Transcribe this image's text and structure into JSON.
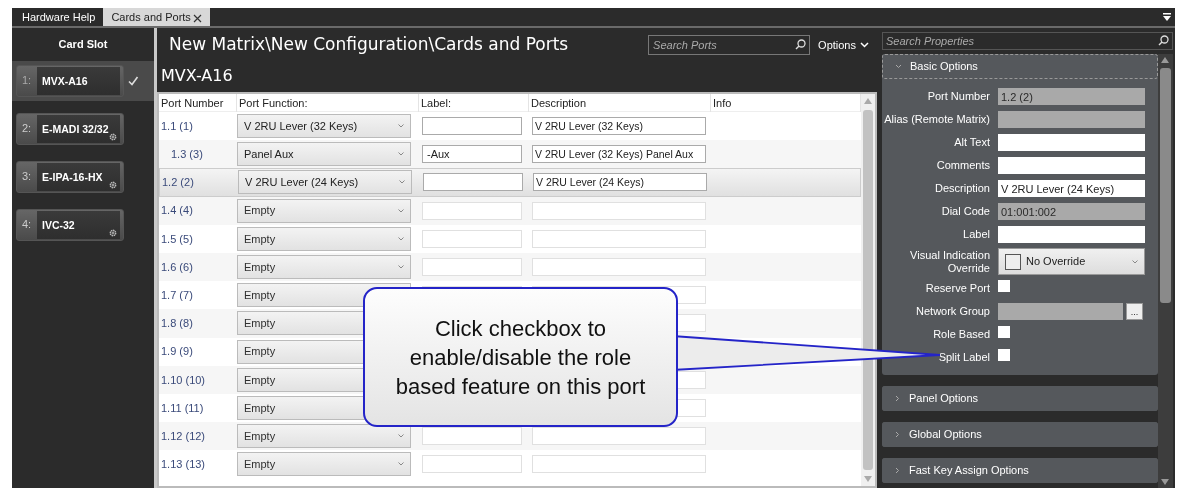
{
  "tabs": [
    {
      "label": "Hardware Help",
      "selected": false,
      "closable": false
    },
    {
      "label": "Cards and Ports",
      "selected": true,
      "closable": true
    }
  ],
  "card_slot": {
    "title": "Card Slot",
    "cards": [
      {
        "number": "1:",
        "name": "MVX-A16",
        "selected": true
      },
      {
        "number": "2:",
        "name": "E-MADI 32/32",
        "selected": false
      },
      {
        "number": "3:",
        "name": "E-IPA-16-HX",
        "selected": false
      },
      {
        "number": "4:",
        "name": "IVC-32",
        "selected": false
      }
    ]
  },
  "header": {
    "path": "New Matrix\\New Configuration\\Cards and Ports",
    "search": {
      "placeholder": "Search Ports"
    },
    "options": "Options"
  },
  "card_title": "MVX-A16",
  "table": {
    "columns": [
      "Port Number",
      "Port Function:",
      "Label:",
      "Description",
      "Info"
    ],
    "rows": [
      {
        "port": "1.1 (1)",
        "function": "V 2RU Lever (32 Keys)",
        "description": "V 2RU Lever (32 Keys)",
        "selected": false,
        "disabled": false,
        "children": [
          {
            "port": "1.3 (3)",
            "function": "Panel Aux",
            "label": "-Aux",
            "description": "V 2RU Lever (32 Keys) Panel Aux",
            "selected": false,
            "disabled": false
          }
        ]
      },
      {
        "port": "1.2 (2)",
        "function": "V 2RU Lever (24 Keys)",
        "description": "V 2RU Lever (24 Keys)",
        "selected": true,
        "disabled": false
      },
      {
        "port": "1.4 (4)",
        "function": "Empty",
        "selected": false,
        "disabled": true
      },
      {
        "port": "1.5 (5)",
        "function": "Empty",
        "selected": false,
        "disabled": true
      },
      {
        "port": "1.6 (6)",
        "function": "Empty",
        "selected": false,
        "disabled": true
      },
      {
        "port": "1.7 (7)",
        "function": "Empty",
        "selected": false,
        "disabled": true
      },
      {
        "port": "1.8 (8)",
        "function": "Empty",
        "selected": false,
        "disabled": true
      },
      {
        "port": "1.9 (9)",
        "function": "Empty",
        "selected": false,
        "disabled": true
      },
      {
        "port": "1.10 (10)",
        "function": "Empty",
        "selected": false,
        "disabled": true
      },
      {
        "port": "1.11 (11)",
        "function": "Empty",
        "selected": false,
        "disabled": true
      },
      {
        "port": "1.12 (12)",
        "function": "Empty",
        "selected": false,
        "disabled": true
      },
      {
        "port": "1.13 (13)",
        "function": "Empty",
        "selected": false,
        "disabled": true
      }
    ]
  },
  "properties": {
    "search": {
      "placeholder": "Search Properties"
    },
    "sections": [
      {
        "title": "Basic Options",
        "expanded": true,
        "fields": [
          {
            "label": "Port Number",
            "kind": "text",
            "value": "1.2 (2)",
            "readonly": true
          },
          {
            "label": "Alias (Remote Matrix)",
            "kind": "text",
            "readonly": true
          },
          {
            "label": "Alt Text",
            "kind": "text",
            "readonly": false
          },
          {
            "label": "Comments",
            "kind": "text",
            "readonly": false
          },
          {
            "label": "Description",
            "kind": "text",
            "value": "V 2RU Lever (24 Keys)",
            "readonly": false
          },
          {
            "label": "Dial Code",
            "kind": "text",
            "value": "01:001:002",
            "readonly": true
          },
          {
            "label": "Label",
            "kind": "text",
            "readonly": false
          },
          {
            "label": "Visual Indication Override",
            "kind": "select",
            "value": "No Override"
          },
          {
            "label": "Reserve Port",
            "kind": "checkbox",
            "checked": false
          },
          {
            "label": "Network Group",
            "kind": "picker",
            "readonly": true,
            "button": "..."
          },
          {
            "label": "Role Based",
            "kind": "checkbox",
            "checked": false
          },
          {
            "label": "Split Label",
            "kind": "checkbox",
            "checked": false
          }
        ]
      },
      {
        "title": "Panel Options",
        "expanded": false
      },
      {
        "title": "Global Options",
        "expanded": false
      },
      {
        "title": "Fast Key Assign Options",
        "expanded": false
      }
    ]
  },
  "callout": {
    "text": "Click checkbox to enable/disable the role based feature on this port"
  }
}
